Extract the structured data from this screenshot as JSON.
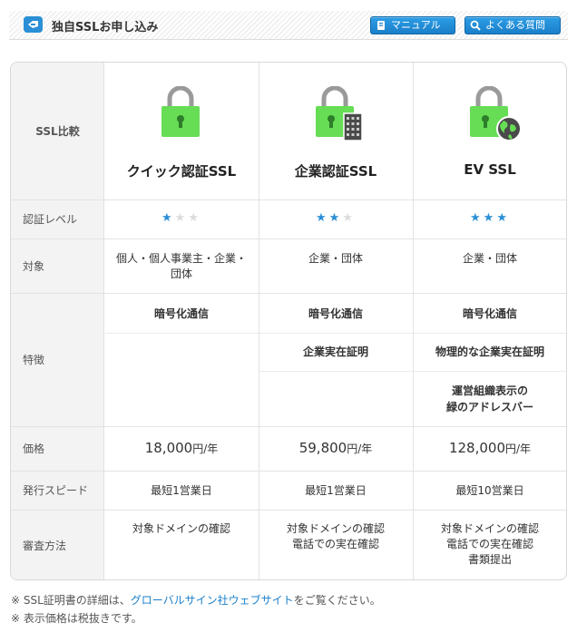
{
  "header": {
    "title": "独自SSLお申し込み",
    "manual_label": "マニュアル",
    "faq_label": "よくある質問"
  },
  "table": {
    "corner_label": "SSL比較",
    "row_labels": {
      "level": "認証レベル",
      "target": "対象",
      "features": "特徴",
      "price": "価格",
      "speed": "発行スピード",
      "review": "審査方法"
    },
    "plans": [
      {
        "name": "クイック認証SSL",
        "stars": 1,
        "target_line1": "個人・個人事業主・企業・",
        "target_line2": "団体",
        "feature1": "暗号化通信",
        "feature2": "",
        "feature3_line1": "",
        "feature3_line2": "",
        "price": "18,000",
        "price_unit": "円/年",
        "speed": "最短1営業日",
        "review_line1": "対象ドメインの確認",
        "review_line2": "",
        "review_line3": ""
      },
      {
        "name": "企業認証SSL",
        "stars": 2,
        "target_line1": "企業・団体",
        "target_line2": "",
        "feature1": "暗号化通信",
        "feature2": "企業実在証明",
        "feature3_line1": "",
        "feature3_line2": "",
        "price": "59,800",
        "price_unit": "円/年",
        "speed": "最短1営業日",
        "review_line1": "対象ドメインの確認",
        "review_line2": "電話での実在確認",
        "review_line3": ""
      },
      {
        "name": "EV SSL",
        "stars": 3,
        "target_line1": "企業・団体",
        "target_line2": "",
        "feature1": "暗号化通信",
        "feature2": "物理的な企業実在証明",
        "feature3_line1": "運営組織表示の",
        "feature3_line2": "緑のアドレスバー",
        "price": "128,000",
        "price_unit": "円/年",
        "speed": "最短10営業日",
        "review_line1": "対象ドメインの確認",
        "review_line2": "電話での実在確認",
        "review_line3": "書類提出"
      }
    ]
  },
  "notes": {
    "line1_prefix": "※ SSL証明書の詳細は、",
    "line1_link": "グローバルサイン社ウェブサイト",
    "line1_suffix": "をご覧ください。",
    "line2": "※ 表示価格は税抜きです。"
  },
  "colors": {
    "accent": "#2a8fd6",
    "lock_green": "#66dd55",
    "star_off": "#dcdcdc"
  }
}
